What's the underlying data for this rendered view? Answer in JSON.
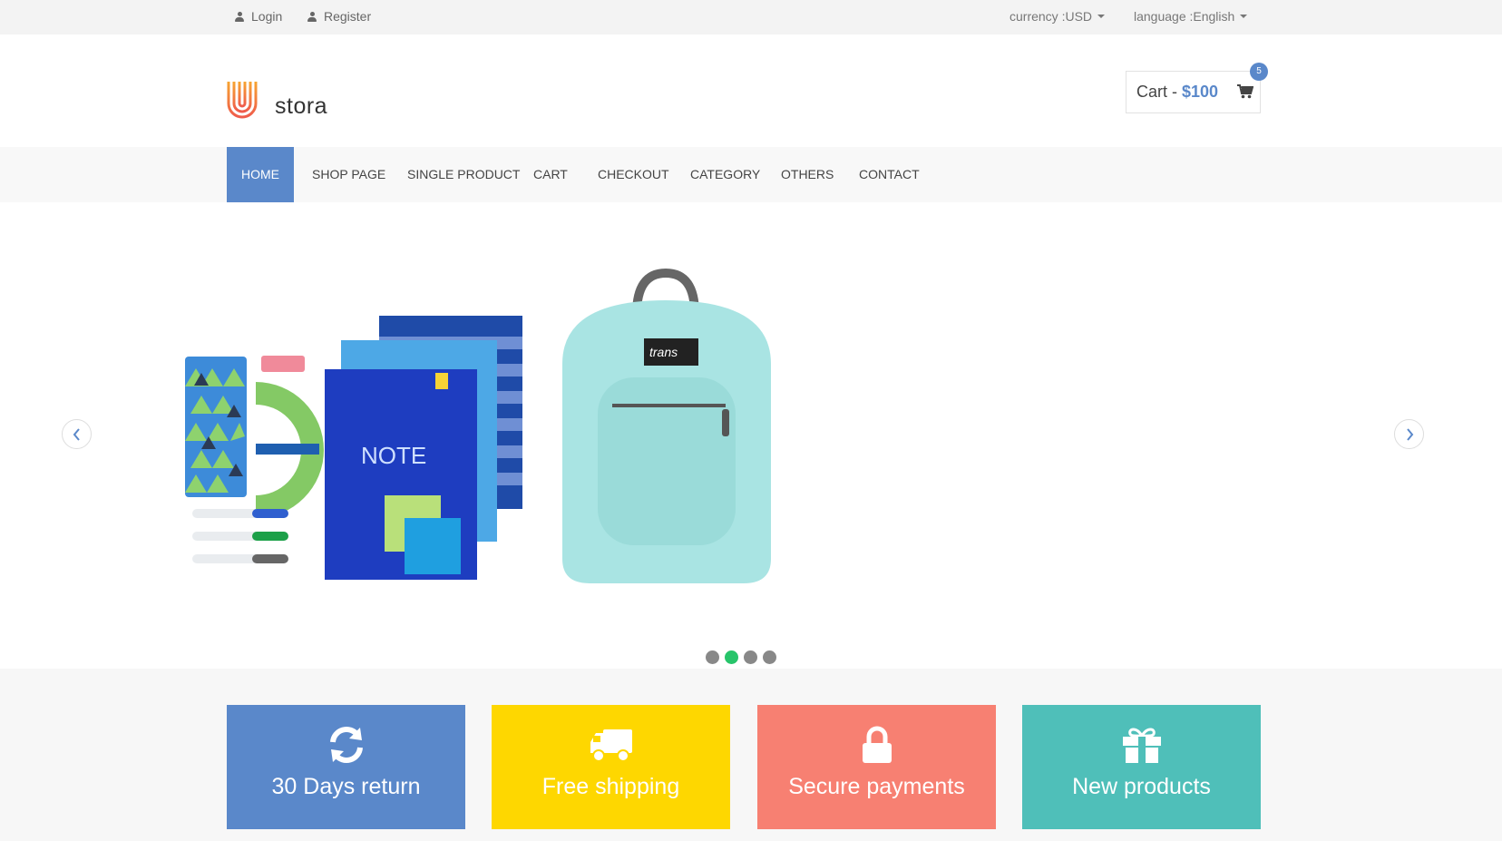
{
  "topbar": {
    "login": "Login",
    "register": "Register",
    "currency": "currency :USD",
    "language": "language :English"
  },
  "header": {
    "logo_text": "stora",
    "cart_label": "Cart -",
    "cart_amount": "$100",
    "cart_count": "5"
  },
  "nav": {
    "items": [
      {
        "label": "HOME"
      },
      {
        "label": "SHOP PAGE"
      },
      {
        "label": "SINGLE PRODUCT"
      },
      {
        "label": "CART"
      },
      {
        "label": "CHECKOUT"
      },
      {
        "label": "CATEGORY"
      },
      {
        "label": "OTHERS"
      },
      {
        "label": "CONTACT"
      }
    ]
  },
  "slider": {
    "slide_count": 4,
    "active_slide": 2
  },
  "promos": [
    {
      "label": "30 Days return",
      "icon": "refresh-icon",
      "color": "#5a88ca"
    },
    {
      "label": "Free shipping",
      "icon": "truck-icon",
      "color": "#fed700"
    },
    {
      "label": "Secure payments",
      "icon": "lock-icon",
      "color": "#f78072"
    },
    {
      "label": "New products",
      "icon": "gift-icon",
      "color": "#4fbfb9"
    }
  ],
  "colors": {
    "accent": "#5a88ca",
    "active_dot": "#27c46a"
  }
}
